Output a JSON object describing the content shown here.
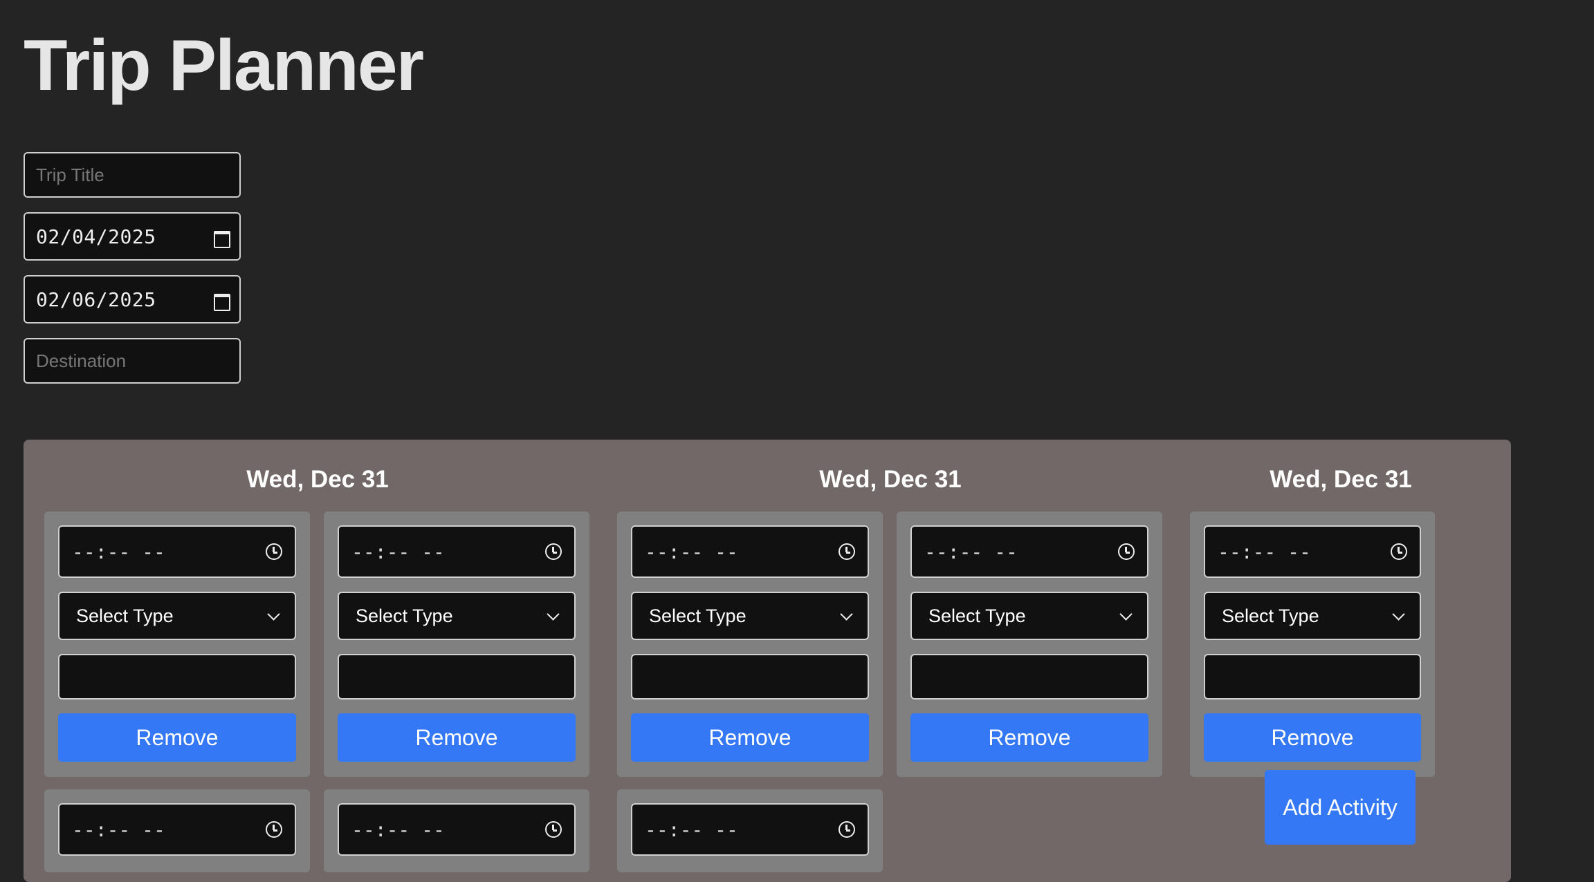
{
  "app": {
    "title": "Trip Planner"
  },
  "form": {
    "trip_title_placeholder": "Trip Title",
    "start_date": "02/04/2025",
    "end_date": "02/06/2025",
    "destination_placeholder": "Destination"
  },
  "days": [
    {
      "label": "Wed, Dec 31"
    },
    {
      "label": "Wed, Dec 31"
    },
    {
      "label": "Wed, Dec 31"
    }
  ],
  "activity": {
    "time_placeholder": "--:-- --",
    "type_placeholder": "Select Type",
    "remove_label": "Remove"
  },
  "add_activity_label": "Add Activity"
}
